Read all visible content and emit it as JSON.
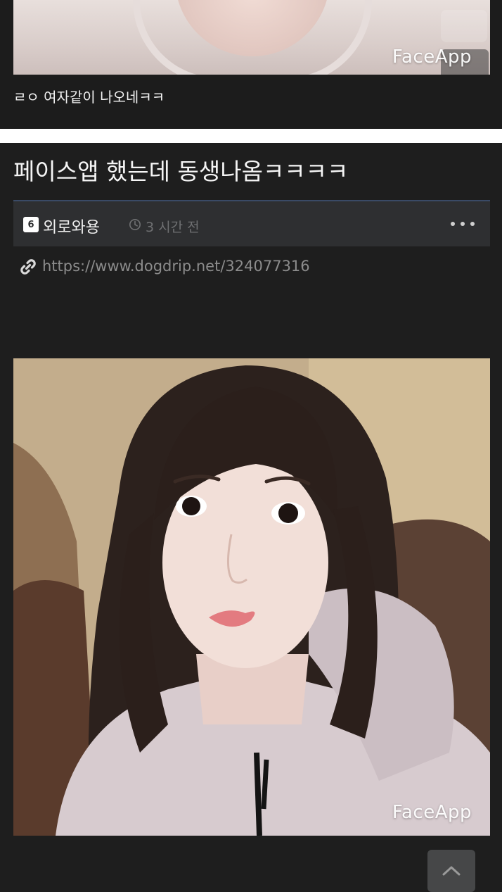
{
  "previous_post": {
    "caption": "ㄹㅇ 여자같이 나오네ㅋㅋ",
    "watermark": "FaceApp"
  },
  "post": {
    "title": "페이스앱 했는데 동생나옴ㅋㅋㅋㅋ",
    "author": {
      "level_badge": "6",
      "name": "외로와용"
    },
    "time_ago": "3 시간 전",
    "link": "https://www.dogdrip.net/324077316",
    "image": {
      "watermark": "FaceApp"
    }
  },
  "icons": {
    "clock": "clock-icon",
    "more": "more-options-icon",
    "link": "link-icon",
    "scroll_top": "chevron-up-icon"
  },
  "colors": {
    "background": "#1e1e1e",
    "meta_bar": "#2e2f31",
    "meta_bar_accent": "#3a4a66",
    "muted_text": "#6f7072",
    "link_text": "#8c8c8c"
  }
}
